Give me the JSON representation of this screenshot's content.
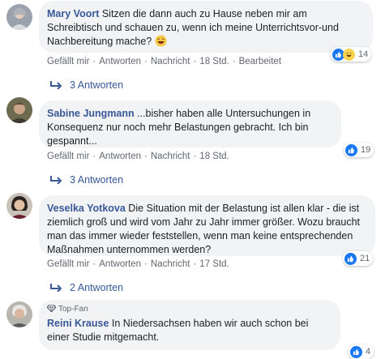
{
  "comments": [
    {
      "author": "Mary Voort",
      "text": " Sitzen die dann auch zu Hause neben mir am Schreibtisch und schauen zu, wenn ich meine Unterrichtsvor-und Nachbereitung mache?",
      "actions": {
        "like": "Gefällt mir",
        "reply": "Antworten",
        "message": "Nachricht",
        "time": "18 Std.",
        "edited": "Bearbeitet"
      },
      "reaction_count": "14",
      "reaction_icons": [
        "like-icon",
        "haha-icon"
      ],
      "replies_label": "3 Antworten"
    },
    {
      "author": "Sabine Jungmann",
      "text": " ...bisher haben alle Untersuchungen in Konsequenz nur noch mehr Belastungen gebracht. Ich bin gespannt...",
      "actions": {
        "like": "Gefällt mir",
        "reply": "Antworten",
        "message": "Nachricht",
        "time": "18 Std."
      },
      "reaction_count": "19",
      "reaction_icons": [
        "like-icon"
      ],
      "replies_label": "3 Antworten"
    },
    {
      "author": "Veselka Yotkova",
      "text": " Die Situation mit der Belastung ist allen klar - die ist ziemlich groß und wird vom Jahr zu Jahr immer größer. Wozu braucht man das immer wieder feststellen, wenn man keine entsprechenden Maßnahmen unternommen werden?",
      "actions": {
        "like": "Gefällt mir",
        "reply": "Antworten",
        "message": "Nachricht",
        "time": "17 Std."
      },
      "reaction_count": "21",
      "reaction_icons": [
        "like-icon"
      ],
      "replies_label": "2 Antworten"
    },
    {
      "badge": "Top-Fan",
      "author": "Reini Krause",
      "text": " In Niedersachsen haben wir auch schon bei einer Studie mitgemacht.",
      "reaction_count": "4",
      "reaction_icons": [
        "like-icon"
      ]
    }
  ],
  "separator": "·",
  "colors": {
    "link": "#385898",
    "bubble": "#f2f3f5",
    "like": "#1877f2",
    "meta": "#606770"
  }
}
